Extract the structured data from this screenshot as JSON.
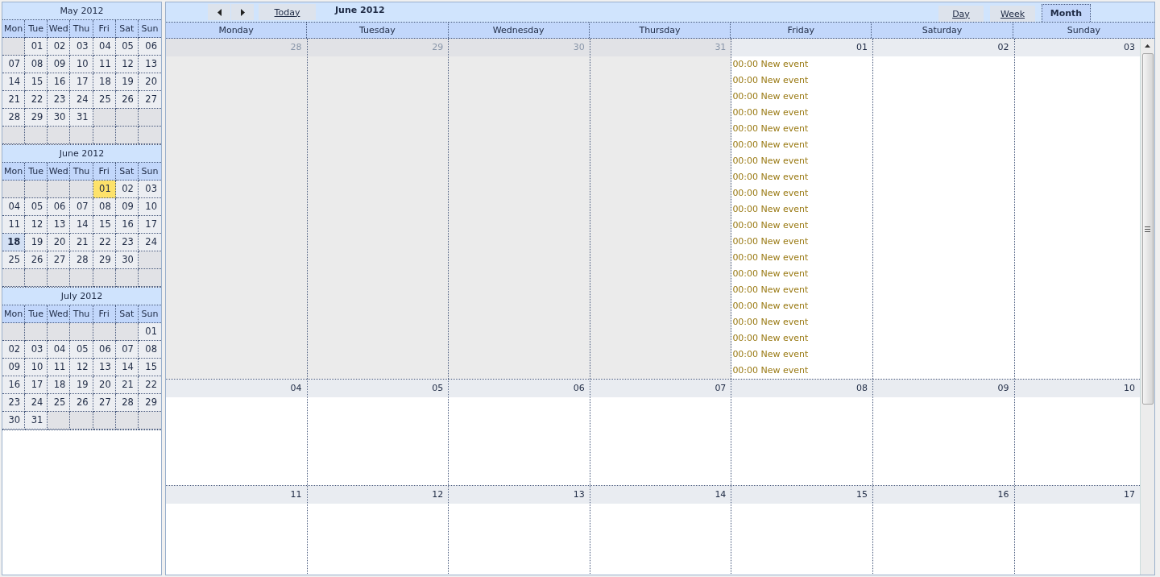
{
  "mini_calendars": [
    {
      "title": "May 2012",
      "weekdays": [
        "Mon",
        "Tue",
        "Wed",
        "Thu",
        "Fri",
        "Sat",
        "Sun"
      ],
      "weeks": [
        [
          {
            "kind": "blank"
          },
          {
            "kind": "day",
            "day": "01",
            "selected": false,
            "today": false
          },
          {
            "kind": "day",
            "day": "02",
            "selected": false,
            "today": false
          },
          {
            "kind": "day",
            "day": "03",
            "selected": false,
            "today": false
          },
          {
            "kind": "day",
            "day": "04",
            "selected": false,
            "today": false
          },
          {
            "kind": "day",
            "day": "05",
            "selected": false,
            "today": false
          },
          {
            "kind": "day",
            "day": "06",
            "selected": false,
            "today": false
          }
        ],
        [
          {
            "kind": "day",
            "day": "07",
            "selected": false,
            "today": false
          },
          {
            "kind": "day",
            "day": "08",
            "selected": false,
            "today": false
          },
          {
            "kind": "day",
            "day": "09",
            "selected": false,
            "today": false
          },
          {
            "kind": "day",
            "day": "10",
            "selected": false,
            "today": false
          },
          {
            "kind": "day",
            "day": "11",
            "selected": false,
            "today": false
          },
          {
            "kind": "day",
            "day": "12",
            "selected": false,
            "today": false
          },
          {
            "kind": "day",
            "day": "13",
            "selected": false,
            "today": false
          }
        ],
        [
          {
            "kind": "day",
            "day": "14",
            "selected": false,
            "today": false
          },
          {
            "kind": "day",
            "day": "15",
            "selected": false,
            "today": false
          },
          {
            "kind": "day",
            "day": "16",
            "selected": false,
            "today": false
          },
          {
            "kind": "day",
            "day": "17",
            "selected": false,
            "today": false
          },
          {
            "kind": "day",
            "day": "18",
            "selected": false,
            "today": false
          },
          {
            "kind": "day",
            "day": "19",
            "selected": false,
            "today": false
          },
          {
            "kind": "day",
            "day": "20",
            "selected": false,
            "today": false
          }
        ],
        [
          {
            "kind": "day",
            "day": "21",
            "selected": false,
            "today": false
          },
          {
            "kind": "day",
            "day": "22",
            "selected": false,
            "today": false
          },
          {
            "kind": "day",
            "day": "23",
            "selected": false,
            "today": false
          },
          {
            "kind": "day",
            "day": "24",
            "selected": false,
            "today": false
          },
          {
            "kind": "day",
            "day": "25",
            "selected": false,
            "today": false
          },
          {
            "kind": "day",
            "day": "26",
            "selected": false,
            "today": false
          },
          {
            "kind": "day",
            "day": "27",
            "selected": false,
            "today": false
          }
        ],
        [
          {
            "kind": "day",
            "day": "28",
            "selected": false,
            "today": false
          },
          {
            "kind": "day",
            "day": "29",
            "selected": false,
            "today": false
          },
          {
            "kind": "day",
            "day": "30",
            "selected": false,
            "today": false
          },
          {
            "kind": "day",
            "day": "31",
            "selected": false,
            "today": false
          },
          {
            "kind": "blank"
          },
          {
            "kind": "blank"
          },
          {
            "kind": "blank"
          }
        ],
        [
          {
            "kind": "blank"
          },
          {
            "kind": "blank"
          },
          {
            "kind": "blank"
          },
          {
            "kind": "blank"
          },
          {
            "kind": "blank"
          },
          {
            "kind": "blank"
          },
          {
            "kind": "blank"
          }
        ]
      ]
    },
    {
      "title": "June 2012",
      "weekdays": [
        "Mon",
        "Tue",
        "Wed",
        "Thu",
        "Fri",
        "Sat",
        "Sun"
      ],
      "weeks": [
        [
          {
            "kind": "blank"
          },
          {
            "kind": "blank"
          },
          {
            "kind": "blank"
          },
          {
            "kind": "blank"
          },
          {
            "kind": "day",
            "day": "01",
            "selected": true,
            "today": false
          },
          {
            "kind": "day",
            "day": "02",
            "selected": false,
            "today": false
          },
          {
            "kind": "day",
            "day": "03",
            "selected": false,
            "today": false
          }
        ],
        [
          {
            "kind": "day",
            "day": "04",
            "selected": false,
            "today": false
          },
          {
            "kind": "day",
            "day": "05",
            "selected": false,
            "today": false
          },
          {
            "kind": "day",
            "day": "06",
            "selected": false,
            "today": false
          },
          {
            "kind": "day",
            "day": "07",
            "selected": false,
            "today": false
          },
          {
            "kind": "day",
            "day": "08",
            "selected": false,
            "today": false
          },
          {
            "kind": "day",
            "day": "09",
            "selected": false,
            "today": false
          },
          {
            "kind": "day",
            "day": "10",
            "selected": false,
            "today": false
          }
        ],
        [
          {
            "kind": "day",
            "day": "11",
            "selected": false,
            "today": false
          },
          {
            "kind": "day",
            "day": "12",
            "selected": false,
            "today": false
          },
          {
            "kind": "day",
            "day": "13",
            "selected": false,
            "today": false
          },
          {
            "kind": "day",
            "day": "14",
            "selected": false,
            "today": false
          },
          {
            "kind": "day",
            "day": "15",
            "selected": false,
            "today": false
          },
          {
            "kind": "day",
            "day": "16",
            "selected": false,
            "today": false
          },
          {
            "kind": "day",
            "day": "17",
            "selected": false,
            "today": false
          }
        ],
        [
          {
            "kind": "day",
            "day": "18",
            "selected": false,
            "today": true
          },
          {
            "kind": "day",
            "day": "19",
            "selected": false,
            "today": false
          },
          {
            "kind": "day",
            "day": "20",
            "selected": false,
            "today": false
          },
          {
            "kind": "day",
            "day": "21",
            "selected": false,
            "today": false
          },
          {
            "kind": "day",
            "day": "22",
            "selected": false,
            "today": false
          },
          {
            "kind": "day",
            "day": "23",
            "selected": false,
            "today": false
          },
          {
            "kind": "day",
            "day": "24",
            "selected": false,
            "today": false
          }
        ],
        [
          {
            "kind": "day",
            "day": "25",
            "selected": false,
            "today": false
          },
          {
            "kind": "day",
            "day": "26",
            "selected": false,
            "today": false
          },
          {
            "kind": "day",
            "day": "27",
            "selected": false,
            "today": false
          },
          {
            "kind": "day",
            "day": "28",
            "selected": false,
            "today": false
          },
          {
            "kind": "day",
            "day": "29",
            "selected": false,
            "today": false
          },
          {
            "kind": "day",
            "day": "30",
            "selected": false,
            "today": false
          },
          {
            "kind": "blank"
          }
        ],
        [
          {
            "kind": "blank"
          },
          {
            "kind": "blank"
          },
          {
            "kind": "blank"
          },
          {
            "kind": "blank"
          },
          {
            "kind": "blank"
          },
          {
            "kind": "blank"
          },
          {
            "kind": "blank"
          }
        ]
      ]
    },
    {
      "title": "July 2012",
      "weekdays": [
        "Mon",
        "Tue",
        "Wed",
        "Thu",
        "Fri",
        "Sat",
        "Sun"
      ],
      "weeks": [
        [
          {
            "kind": "blank"
          },
          {
            "kind": "blank"
          },
          {
            "kind": "blank"
          },
          {
            "kind": "blank"
          },
          {
            "kind": "blank"
          },
          {
            "kind": "blank"
          },
          {
            "kind": "day",
            "day": "01",
            "selected": false,
            "today": false
          }
        ],
        [
          {
            "kind": "day",
            "day": "02",
            "selected": false,
            "today": false
          },
          {
            "kind": "day",
            "day": "03",
            "selected": false,
            "today": false
          },
          {
            "kind": "day",
            "day": "04",
            "selected": false,
            "today": false
          },
          {
            "kind": "day",
            "day": "05",
            "selected": false,
            "today": false
          },
          {
            "kind": "day",
            "day": "06",
            "selected": false,
            "today": false
          },
          {
            "kind": "day",
            "day": "07",
            "selected": false,
            "today": false
          },
          {
            "kind": "day",
            "day": "08",
            "selected": false,
            "today": false
          }
        ],
        [
          {
            "kind": "day",
            "day": "09",
            "selected": false,
            "today": false
          },
          {
            "kind": "day",
            "day": "10",
            "selected": false,
            "today": false
          },
          {
            "kind": "day",
            "day": "11",
            "selected": false,
            "today": false
          },
          {
            "kind": "day",
            "day": "12",
            "selected": false,
            "today": false
          },
          {
            "kind": "day",
            "day": "13",
            "selected": false,
            "today": false
          },
          {
            "kind": "day",
            "day": "14",
            "selected": false,
            "today": false
          },
          {
            "kind": "day",
            "day": "15",
            "selected": false,
            "today": false
          }
        ],
        [
          {
            "kind": "day",
            "day": "16",
            "selected": false,
            "today": false
          },
          {
            "kind": "day",
            "day": "17",
            "selected": false,
            "today": false
          },
          {
            "kind": "day",
            "day": "18",
            "selected": false,
            "today": false
          },
          {
            "kind": "day",
            "day": "19",
            "selected": false,
            "today": false
          },
          {
            "kind": "day",
            "day": "20",
            "selected": false,
            "today": false
          },
          {
            "kind": "day",
            "day": "21",
            "selected": false,
            "today": false
          },
          {
            "kind": "day",
            "day": "22",
            "selected": false,
            "today": false
          }
        ],
        [
          {
            "kind": "day",
            "day": "23",
            "selected": false,
            "today": false
          },
          {
            "kind": "day",
            "day": "24",
            "selected": false,
            "today": false
          },
          {
            "kind": "day",
            "day": "25",
            "selected": false,
            "today": false
          },
          {
            "kind": "day",
            "day": "26",
            "selected": false,
            "today": false
          },
          {
            "kind": "day",
            "day": "27",
            "selected": false,
            "today": false
          },
          {
            "kind": "day",
            "day": "28",
            "selected": false,
            "today": false
          },
          {
            "kind": "day",
            "day": "29",
            "selected": false,
            "today": false
          }
        ],
        [
          {
            "kind": "day",
            "day": "30",
            "selected": false,
            "today": false
          },
          {
            "kind": "day",
            "day": "31",
            "selected": false,
            "today": false
          },
          {
            "kind": "blank"
          },
          {
            "kind": "blank"
          },
          {
            "kind": "blank"
          },
          {
            "kind": "blank"
          },
          {
            "kind": "blank"
          }
        ]
      ]
    }
  ],
  "toolbar": {
    "today_button": "Today",
    "title": "June 2012",
    "views": [
      {
        "label": "Day",
        "selected": false
      },
      {
        "label": "Week",
        "selected": false
      },
      {
        "label": "Month",
        "selected": true
      }
    ]
  },
  "month_view": {
    "weekdays": [
      "Monday",
      "Tuesday",
      "Wednesday",
      "Thursday",
      "Friday",
      "Saturday",
      "Sunday"
    ],
    "weeks": [
      {
        "days": [
          {
            "day": "28",
            "outside": true
          },
          {
            "day": "29",
            "outside": true
          },
          {
            "day": "30",
            "outside": true
          },
          {
            "day": "31",
            "outside": true
          },
          {
            "day": "01",
            "outside": false,
            "events": [
              "00:00 New event",
              "00:00 New event",
              "00:00 New event",
              "00:00 New event",
              "00:00 New event",
              "00:00 New event",
              "00:00 New event",
              "00:00 New event",
              "00:00 New event",
              "00:00 New event",
              "00:00 New event",
              "00:00 New event",
              "00:00 New event",
              "00:00 New event",
              "00:00 New event",
              "00:00 New event",
              "00:00 New event",
              "00:00 New event",
              "00:00 New event",
              "00:00 New event"
            ]
          },
          {
            "day": "02",
            "outside": false
          },
          {
            "day": "03",
            "outside": false
          }
        ]
      },
      {
        "days": [
          {
            "day": "04",
            "outside": false
          },
          {
            "day": "05",
            "outside": false
          },
          {
            "day": "06",
            "outside": false
          },
          {
            "day": "07",
            "outside": false
          },
          {
            "day": "08",
            "outside": false
          },
          {
            "day": "09",
            "outside": false
          },
          {
            "day": "10",
            "outside": false
          }
        ]
      },
      {
        "days": [
          {
            "day": "11",
            "outside": false
          },
          {
            "day": "12",
            "outside": false
          },
          {
            "day": "13",
            "outside": false
          },
          {
            "day": "14",
            "outside": false
          },
          {
            "day": "15",
            "outside": false
          },
          {
            "day": "16",
            "outside": false
          },
          {
            "day": "17",
            "outside": false
          }
        ]
      }
    ]
  }
}
